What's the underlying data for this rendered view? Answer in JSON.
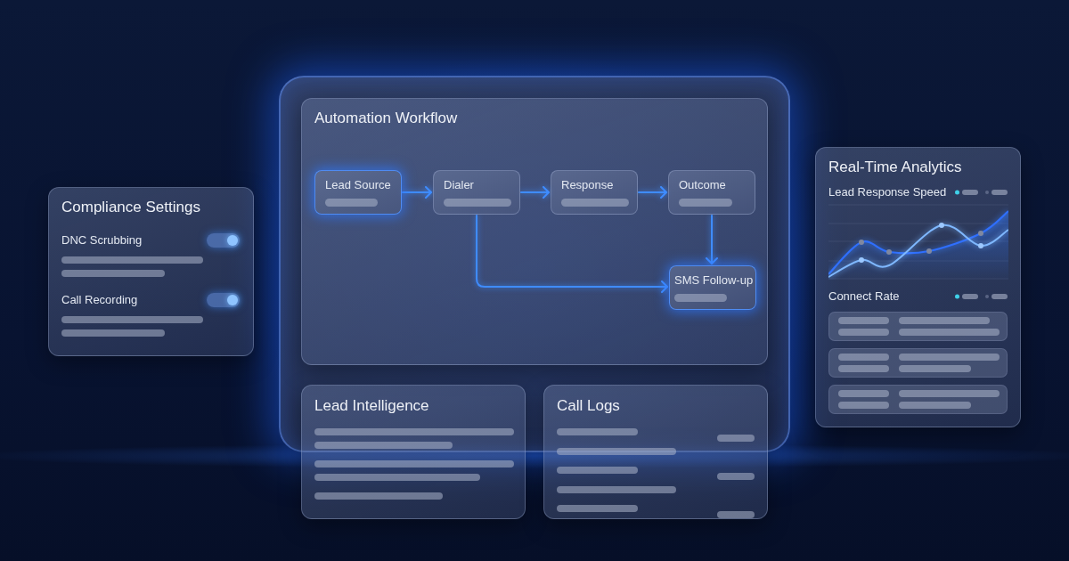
{
  "compliance_settings": {
    "title": "Compliance Settings",
    "settings": [
      {
        "label": "DNC Scrubbing",
        "on": true
      },
      {
        "label": "Call Recording",
        "on": true
      }
    ]
  },
  "automation_workflow": {
    "title": "Automation Workflow",
    "nodes": [
      {
        "label": "Lead Source",
        "highlighted": true
      },
      {
        "label": "Dialer",
        "highlighted": false
      },
      {
        "label": "Response",
        "highlighted": false
      },
      {
        "label": "Outcome",
        "highlighted": false
      },
      {
        "label": "SMS Follow-up",
        "highlighted": true
      }
    ]
  },
  "lead_intelligence": {
    "title": "Lead Intelligence"
  },
  "call_logs": {
    "title": "Call Logs"
  },
  "real_time_analytics": {
    "title": "Real-Time Analytics",
    "chart_label": "Lead Response Speed",
    "list_label": "Connect Rate"
  }
}
